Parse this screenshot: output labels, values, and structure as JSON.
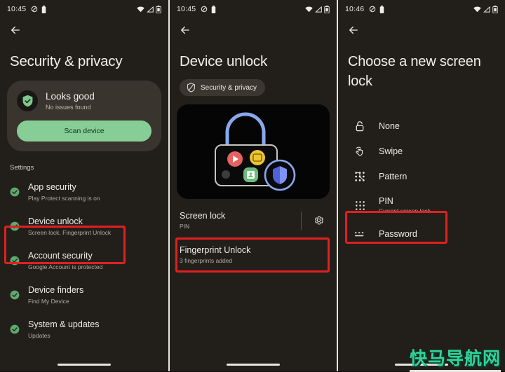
{
  "watermark": {
    "text": "快马导航网"
  },
  "panels": [
    {
      "id": "security-privacy",
      "status": {
        "time": "10:45",
        "icons": [
          "dnd-icon",
          "battery-saver-icon",
          "wifi-icon",
          "signal-icon",
          "battery-icon"
        ]
      },
      "back_label": "back-arrow",
      "title": "Security & privacy",
      "card": {
        "icon": "shield-check-icon",
        "title": "Looks good",
        "subtitle": "No issues found",
        "button_label": "Scan device",
        "button_color": "#86ce96"
      },
      "section_label": "Settings",
      "items": [
        {
          "title": "App security",
          "subtitle": "Play Protect scanning is on",
          "icon": "check-circle-icon"
        },
        {
          "title": "Device unlock",
          "subtitle": "Screen lock, Fingerprint Unlock",
          "icon": "check-circle-icon",
          "highlighted": true
        },
        {
          "title": "Account security",
          "subtitle": "Google Account is protected",
          "icon": "check-circle-icon"
        },
        {
          "title": "Device finders",
          "subtitle": "Find My Device",
          "icon": "check-circle-icon"
        },
        {
          "title": "System & updates",
          "subtitle": "Updates",
          "icon": "check-circle-icon"
        }
      ]
    },
    {
      "id": "device-unlock",
      "status": {
        "time": "10:45"
      },
      "title": "Device unlock",
      "chip": {
        "label": "Security & privacy",
        "icon": "shield-icon"
      },
      "illustration": {
        "name": "padlock-apps-illustration"
      },
      "items": [
        {
          "title": "Screen lock",
          "subtitle": "PIN",
          "trailing_icon": "gear-icon",
          "highlighted": true
        },
        {
          "title": "Fingerprint Unlock",
          "subtitle": "3 fingerprints added"
        }
      ]
    },
    {
      "id": "choose-screen-lock",
      "status": {
        "time": "10:46"
      },
      "title": "Choose a new screen lock",
      "choices": [
        {
          "title": "None",
          "subtitle": "",
          "icon": "lock-open-icon"
        },
        {
          "title": "Swipe",
          "subtitle": "",
          "icon": "swipe-icon"
        },
        {
          "title": "Pattern",
          "subtitle": "",
          "icon": "pattern-icon"
        },
        {
          "title": "PIN",
          "subtitle": "Current screen lock",
          "icon": "pin-dots-icon",
          "highlighted": true
        },
        {
          "title": "Password",
          "subtitle": "",
          "icon": "password-icon"
        }
      ]
    }
  ],
  "colors": {
    "highlight": "#e02020",
    "accent_green": "#86ce96",
    "panel_bg": "#221f1b",
    "card_bg": "#39342e"
  }
}
